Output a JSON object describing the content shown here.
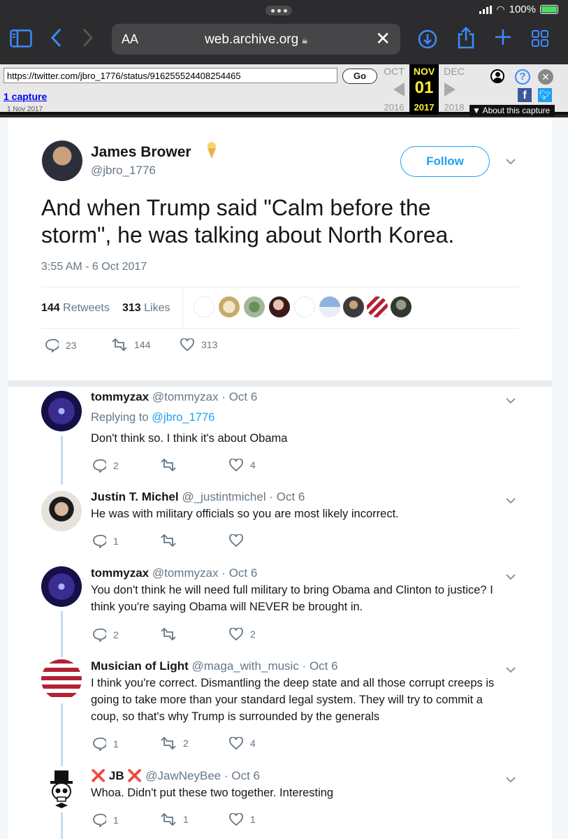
{
  "browser": {
    "battery": "100%",
    "reader_label": "AA",
    "domain": "web.archive.org"
  },
  "wayback": {
    "url_value": "https://twitter.com/jbro_1776/status/916255524408254465",
    "go_label": "Go",
    "captures_label": "1 capture",
    "capture_date": "1 Nov 2017",
    "prev_month": "OCT",
    "cur_month": "NOV",
    "next_month": "DEC",
    "cur_day": "01",
    "prev_year": "2016",
    "cur_year": "2017",
    "next_year": "2018",
    "about_label": "About this capture"
  },
  "tweet": {
    "author_name": "James Brower",
    "author_handle": "@jbro_1776",
    "follow_label": "Follow",
    "text_line1": "And when Trump said \"Calm before the",
    "text_line2": "storm\", he was talking about North Korea.",
    "time": "3:55 AM - 6 Oct 2017",
    "retweets_count": "144",
    "retweets_label": "Retweets",
    "likes_count": "313",
    "likes_label": "Likes",
    "reply_count": "23",
    "retweet_count": "144",
    "like_count": "313"
  },
  "replies": [
    {
      "name": "tommyzax",
      "handle": "@tommyzax · Oct 6",
      "replying_prefix": "Replying to",
      "replying_handle": "@jbro_1776",
      "lines": [
        "Don't think so. I think it's about Obama"
      ],
      "reply_count": "2",
      "retweet_count": "",
      "like_count": "4"
    },
    {
      "name": "Justin T. Michel",
      "handle": "@_justintmichel · Oct 6",
      "lines": [
        "He was with military officials so you are most likely incorrect."
      ],
      "reply_count": "1",
      "retweet_count": "",
      "like_count": ""
    },
    {
      "name": "tommyzax",
      "handle": "@tommyzax · Oct 6",
      "lines": [
        "You don't think he will need full military to bring Obama and Clinton to justice? I",
        "think you're saying Obama will NEVER be brought in."
      ],
      "reply_count": "2",
      "retweet_count": "",
      "like_count": "2"
    },
    {
      "name": "Musician of Light",
      "handle": "@maga_with_music · Oct 6",
      "lines": [
        "I think you're correct. Dismantling the deep state and all those corrupt creeps is",
        "going to take more than your standard legal system. They will try to commit a",
        "coup, so that's why Trump is surrounded by the generals"
      ],
      "reply_count": "1",
      "retweet_count": "2",
      "like_count": "4"
    },
    {
      "name_mark": "❌",
      "name": "JB",
      "handle": "@JawNeyBee · Oct 6",
      "lines": [
        "Whoa. Didn't put these two together. Interesting"
      ],
      "reply_count": "1",
      "retweet_count": "1",
      "like_count": "1"
    }
  ],
  "colors": {
    "twitter_blue": "#1da1f2",
    "safari_blue": "#3b8bff",
    "wayback_highlight": "#ffef33"
  }
}
